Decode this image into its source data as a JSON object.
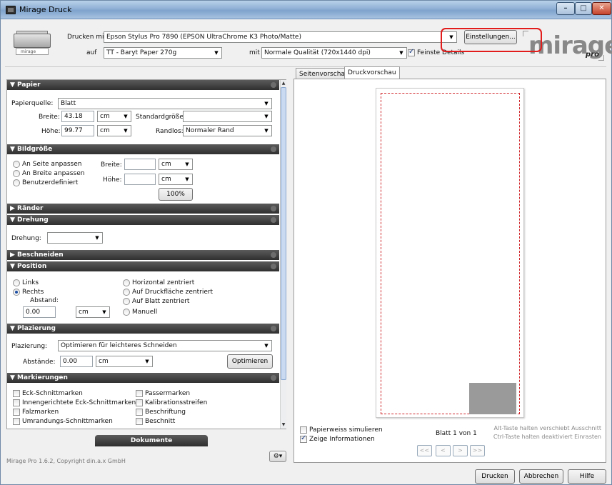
{
  "window": {
    "title": "Mirage Druck"
  },
  "header": {
    "print_with_label": "Drucken mit",
    "printer_value": "Epson Stylus Pro 7890 (EPSON UltraChrome K3 Photo/Matte)",
    "on_label": "auf",
    "paper_value": "TT - Baryt Paper 270g",
    "with_label": "mit",
    "quality_value": "Normale Qualität (720x1440 dpi)",
    "fine_details_label": "Feinste Details",
    "settings_button": "Einstellungen...",
    "printer_badge": "mirage",
    "logo_text": "mirage",
    "logo_sub": "pro"
  },
  "papier": {
    "section": "▼ Papier",
    "source_label": "Papierquelle:",
    "source_value": "Blatt",
    "width_label": "Breite:",
    "width_value": "43.18",
    "width_unit": "cm",
    "height_label": "Höhe:",
    "height_value": "99.77",
    "height_unit": "cm",
    "standard_label": "Standardgröße:",
    "standard_value": "",
    "borderless_label": "Randlos:",
    "borderless_value": "Normaler Rand"
  },
  "bildgroesse": {
    "section": "▼ Bildgröße",
    "opt1": "An Seite anpassen",
    "opt2": "An Breite anpassen",
    "opt3": "Benutzerdefiniert",
    "width_label": "Breite:",
    "width_unit": "cm",
    "height_label": "Höhe:",
    "height_unit": "cm",
    "percent_button": "100%"
  },
  "raender": {
    "section": "▶ Ränder"
  },
  "drehung": {
    "section": "▼ Drehung",
    "label": "Drehung:",
    "value": ""
  },
  "beschneiden": {
    "section": "▶ Beschneiden"
  },
  "position": {
    "section": "▼ Position",
    "links": "Links",
    "rechts": "Rechts",
    "abstand_label": "Abstand:",
    "abstand_value": "0.00",
    "abstand_unit": "cm",
    "h_center": "Horizontal zentriert",
    "print_center": "Auf Druckfläche zentriert",
    "sheet_center": "Auf Blatt zentriert",
    "manual": "Manuell"
  },
  "plazierung": {
    "section": "▼ Plazierung",
    "label": "Plazierung:",
    "value": "Optimieren für leichteres Schneiden",
    "spacing_label": "Abstände:",
    "spacing_value": "0.00",
    "spacing_unit": "cm",
    "optimize_button": "Optimieren"
  },
  "markierungen": {
    "section": "▼ Markierungen",
    "items_left": [
      "Eck-Schnittmarken",
      "Innengerichtete Eck-Schnittmarken",
      "Falzmarken",
      "Umrandungs-Schnittmarken"
    ],
    "items_right": [
      "Passermarken",
      "Kalibrationsstreifen",
      "Beschriftung",
      "Beschnitt"
    ]
  },
  "dokumente_tab": "Dokumente",
  "footer": {
    "version": "Mirage Pro 1.6.2, Copyright din.a.x GmbH"
  },
  "preview": {
    "tab_page": "Seitenvorschau",
    "tab_print": "Druckvorschau",
    "simulate_paper": "Papierweiss simulieren",
    "show_info": "Zeige Informationen",
    "sheet_info": "Blatt 1 von 1",
    "hint1": "Alt-Taste halten verschiebt Ausschnitt",
    "hint2": "Ctrl-Taste halten deaktiviert Einrasten",
    "nav_first": "<<",
    "nav_prev": "<",
    "nav_next": ">",
    "nav_last": ">>"
  },
  "actions": {
    "print": "Drucken",
    "cancel": "Abbrechen",
    "help": "Hilfe"
  }
}
